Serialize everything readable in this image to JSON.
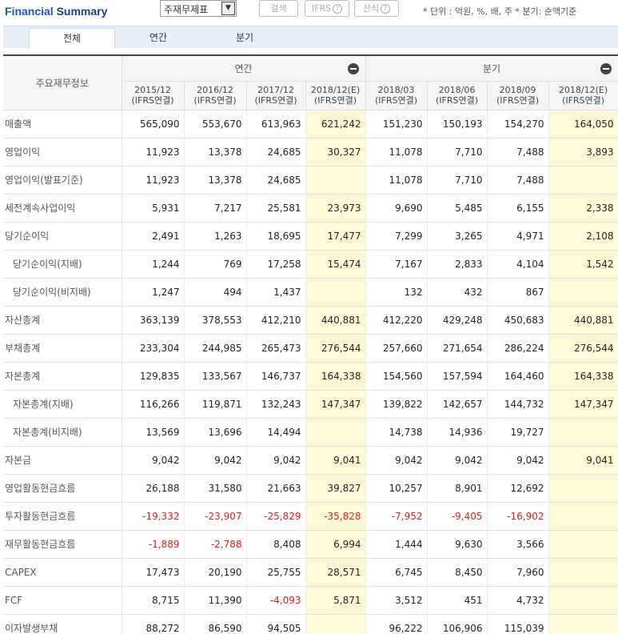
{
  "header": {
    "title_part1": "Financial",
    "title_part2": " Summary",
    "select_value": "주재무제표",
    "search_label": "검색",
    "ifrs_label": "IFRS",
    "formula_label": "산식",
    "help_symbol": "?",
    "unit_note": "* 단위 : 억원, %, 배, 주   * 분기: 순액기준"
  },
  "tabs": [
    "전체",
    "연간",
    "분기"
  ],
  "table": {
    "row_header": "주요재무정보",
    "group_annual": "연간",
    "group_quarter": "분기",
    "periods": [
      {
        "date": "2015/12",
        "basis": "(IFRS연결)"
      },
      {
        "date": "2016/12",
        "basis": "(IFRS연결)"
      },
      {
        "date": "2017/12",
        "basis": "(IFRS연결)"
      },
      {
        "date": "2018/12(E)",
        "basis": "(IFRS연결)"
      },
      {
        "date": "2018/03",
        "basis": "(IFRS연결)"
      },
      {
        "date": "2018/06",
        "basis": "(IFRS연결)"
      },
      {
        "date": "2018/09",
        "basis": "(IFRS연결)"
      },
      {
        "date": "2018/12(E)",
        "basis": "(IFRS연결)"
      }
    ],
    "rows": [
      {
        "label": "매출액",
        "sub": false,
        "values": [
          "565,090",
          "553,670",
          "613,963",
          "621,242",
          "151,230",
          "150,193",
          "154,270",
          "164,050"
        ]
      },
      {
        "label": "영업이익",
        "sub": false,
        "values": [
          "11,923",
          "13,378",
          "24,685",
          "30,327",
          "11,078",
          "7,710",
          "7,488",
          "3,893"
        ]
      },
      {
        "label": "영업이익(발표기준)",
        "sub": false,
        "values": [
          "11,923",
          "13,378",
          "24,685",
          "",
          "11,078",
          "7,710",
          "7,488",
          ""
        ]
      },
      {
        "label": "세전계속사업이익",
        "sub": false,
        "values": [
          "5,931",
          "7,217",
          "25,581",
          "23,973",
          "9,690",
          "5,485",
          "6,155",
          "2,338"
        ]
      },
      {
        "label": "당기순이익",
        "sub": false,
        "values": [
          "2,491",
          "1,263",
          "18,695",
          "17,477",
          "7,299",
          "3,265",
          "4,971",
          "2,108"
        ]
      },
      {
        "label": "당기순이익(지배)",
        "sub": true,
        "values": [
          "1,244",
          "769",
          "17,258",
          "15,474",
          "7,167",
          "2,833",
          "4,104",
          "1,542"
        ]
      },
      {
        "label": "당기순이익(비지배)",
        "sub": true,
        "values": [
          "1,247",
          "494",
          "1,437",
          "",
          "132",
          "432",
          "867",
          ""
        ]
      },
      {
        "label": "자산총계",
        "sub": false,
        "values": [
          "363,139",
          "378,553",
          "412,210",
          "440,881",
          "412,220",
          "429,248",
          "450,683",
          "440,881"
        ]
      },
      {
        "label": "부채총계",
        "sub": false,
        "values": [
          "233,304",
          "244,985",
          "265,473",
          "276,544",
          "257,660",
          "271,654",
          "286,224",
          "276,544"
        ]
      },
      {
        "label": "자본총계",
        "sub": false,
        "values": [
          "129,835",
          "133,567",
          "146,737",
          "164,338",
          "154,560",
          "157,594",
          "164,460",
          "164,338"
        ]
      },
      {
        "label": "자본총계(지배)",
        "sub": true,
        "values": [
          "116,266",
          "119,871",
          "132,243",
          "147,347",
          "139,822",
          "142,657",
          "144,732",
          "147,347"
        ]
      },
      {
        "label": "자본총계(비지배)",
        "sub": true,
        "values": [
          "13,569",
          "13,696",
          "14,494",
          "",
          "14,738",
          "14,936",
          "19,727",
          ""
        ]
      },
      {
        "label": "자본금",
        "sub": false,
        "values": [
          "9,042",
          "9,042",
          "9,042",
          "9,041",
          "9,042",
          "9,042",
          "9,042",
          "9,041"
        ]
      },
      {
        "label": "영업활동현금흐름",
        "sub": false,
        "values": [
          "26,188",
          "31,580",
          "21,663",
          "39,827",
          "10,257",
          "8,901",
          "12,692",
          ""
        ]
      },
      {
        "label": "투자활동현금흐름",
        "sub": false,
        "values": [
          "-19,332",
          "-23,907",
          "-25,829",
          "-35,828",
          "-7,952",
          "-9,405",
          "-16,902",
          ""
        ]
      },
      {
        "label": "재무활동현금흐름",
        "sub": false,
        "values": [
          "-1,889",
          "-2,788",
          "8,408",
          "6,994",
          "1,444",
          "9,630",
          "3,566",
          ""
        ]
      },
      {
        "label": "CAPEX",
        "sub": false,
        "values": [
          "17,473",
          "20,190",
          "25,755",
          "28,571",
          "6,745",
          "8,450",
          "7,960",
          ""
        ]
      },
      {
        "label": "FCF",
        "sub": false,
        "values": [
          "8,715",
          "11,390",
          "-4,093",
          "5,871",
          "3,512",
          "451",
          "4,732",
          ""
        ]
      },
      {
        "label": "이자발생부채",
        "sub": false,
        "values": [
          "88,272",
          "86,590",
          "94,505",
          "",
          "96,222",
          "106,906",
          "115,039",
          ""
        ]
      }
    ]
  },
  "colors": {
    "negative": "#e01e1e",
    "estimate_bg": "#fdf9d8",
    "title": "#1a3f86"
  }
}
